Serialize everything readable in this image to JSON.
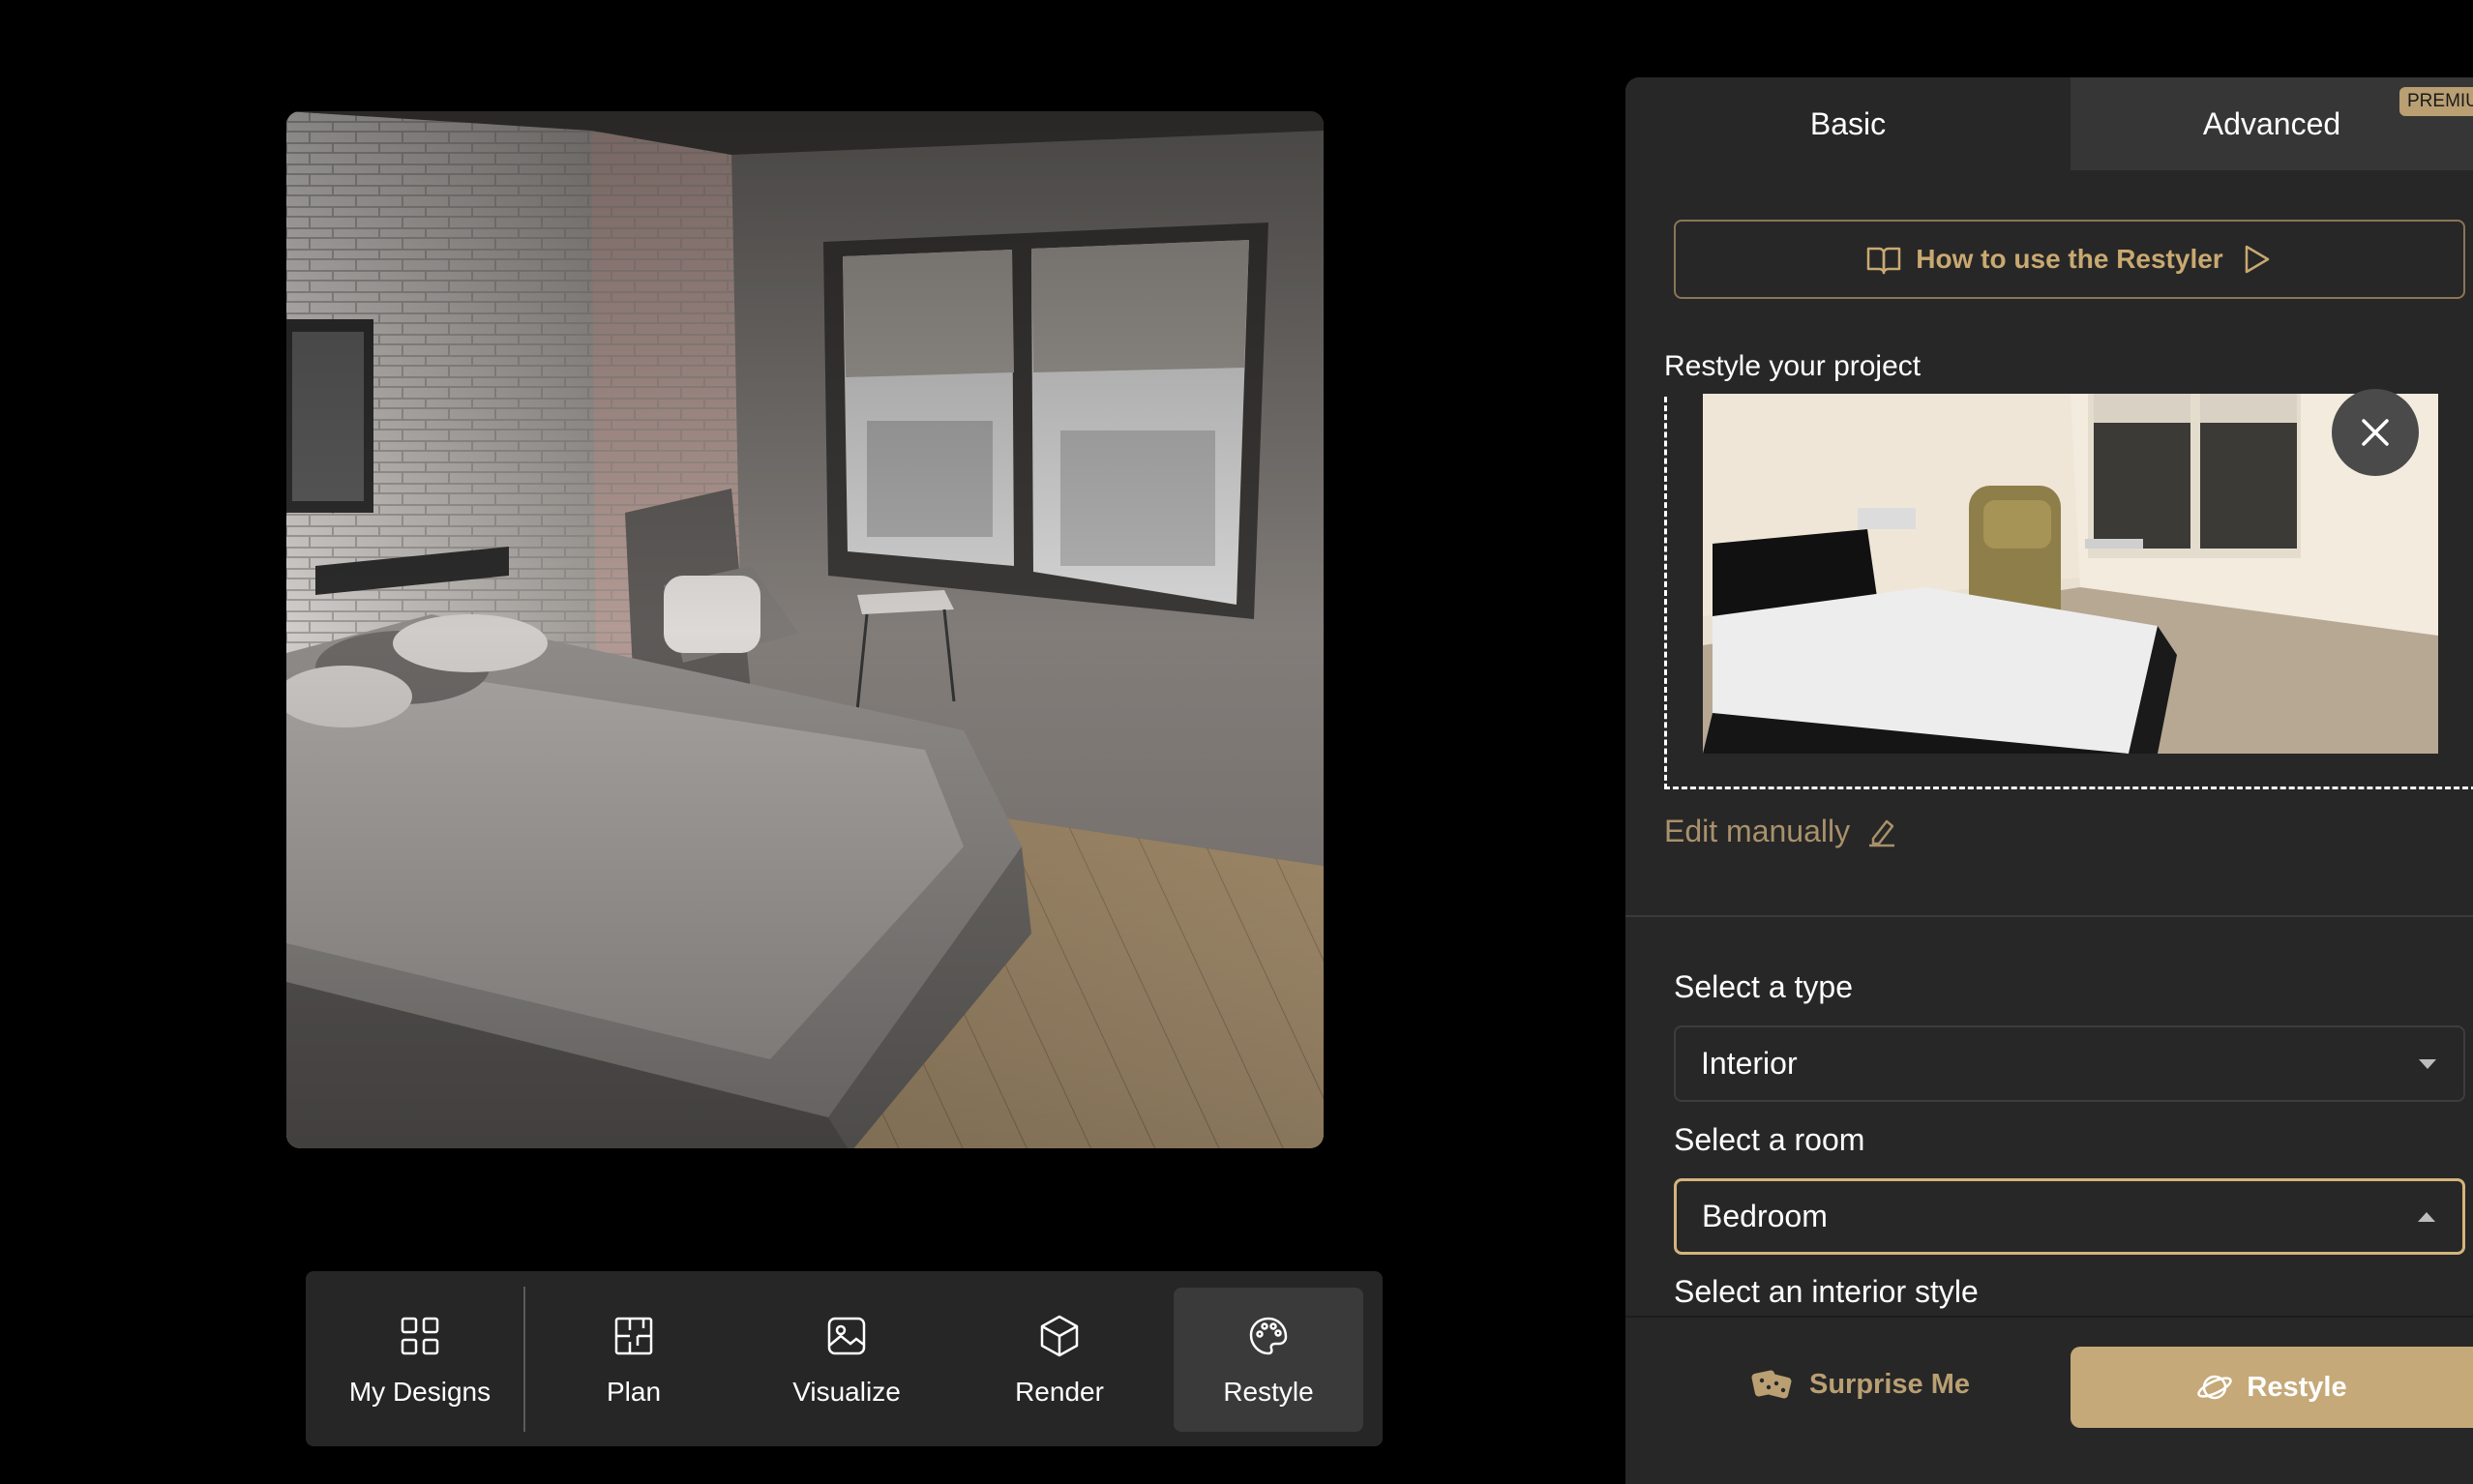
{
  "toolbar": {
    "items": [
      {
        "label": "My Designs",
        "icon": "grid-icon"
      },
      {
        "label": "Plan",
        "icon": "floor-plan-icon"
      },
      {
        "label": "Visualize",
        "icon": "image-icon"
      },
      {
        "label": "Render",
        "icon": "cube-icon"
      },
      {
        "label": "Restyle",
        "icon": "palette-icon",
        "active": true
      }
    ]
  },
  "panel": {
    "tabs": [
      {
        "label": "Basic",
        "active": true
      },
      {
        "label": "Advanced",
        "badge": "PREMIUM"
      }
    ],
    "howto_label": "How to use the Restyler",
    "restyle_label": "Restyle your project",
    "edit_label": "Edit manually",
    "type_label": "Select a type",
    "type_value": "Interior",
    "room_label": "Select a room",
    "room_value": "Bedroom",
    "style_label": "Select an interior style",
    "surprise_label": "Surprise Me",
    "restyle_button": "Restyle"
  },
  "colors": {
    "accent": "#c6a978",
    "accent_text": "#c9a971",
    "panel_bg": "#272727",
    "page_bg": "#000000"
  }
}
